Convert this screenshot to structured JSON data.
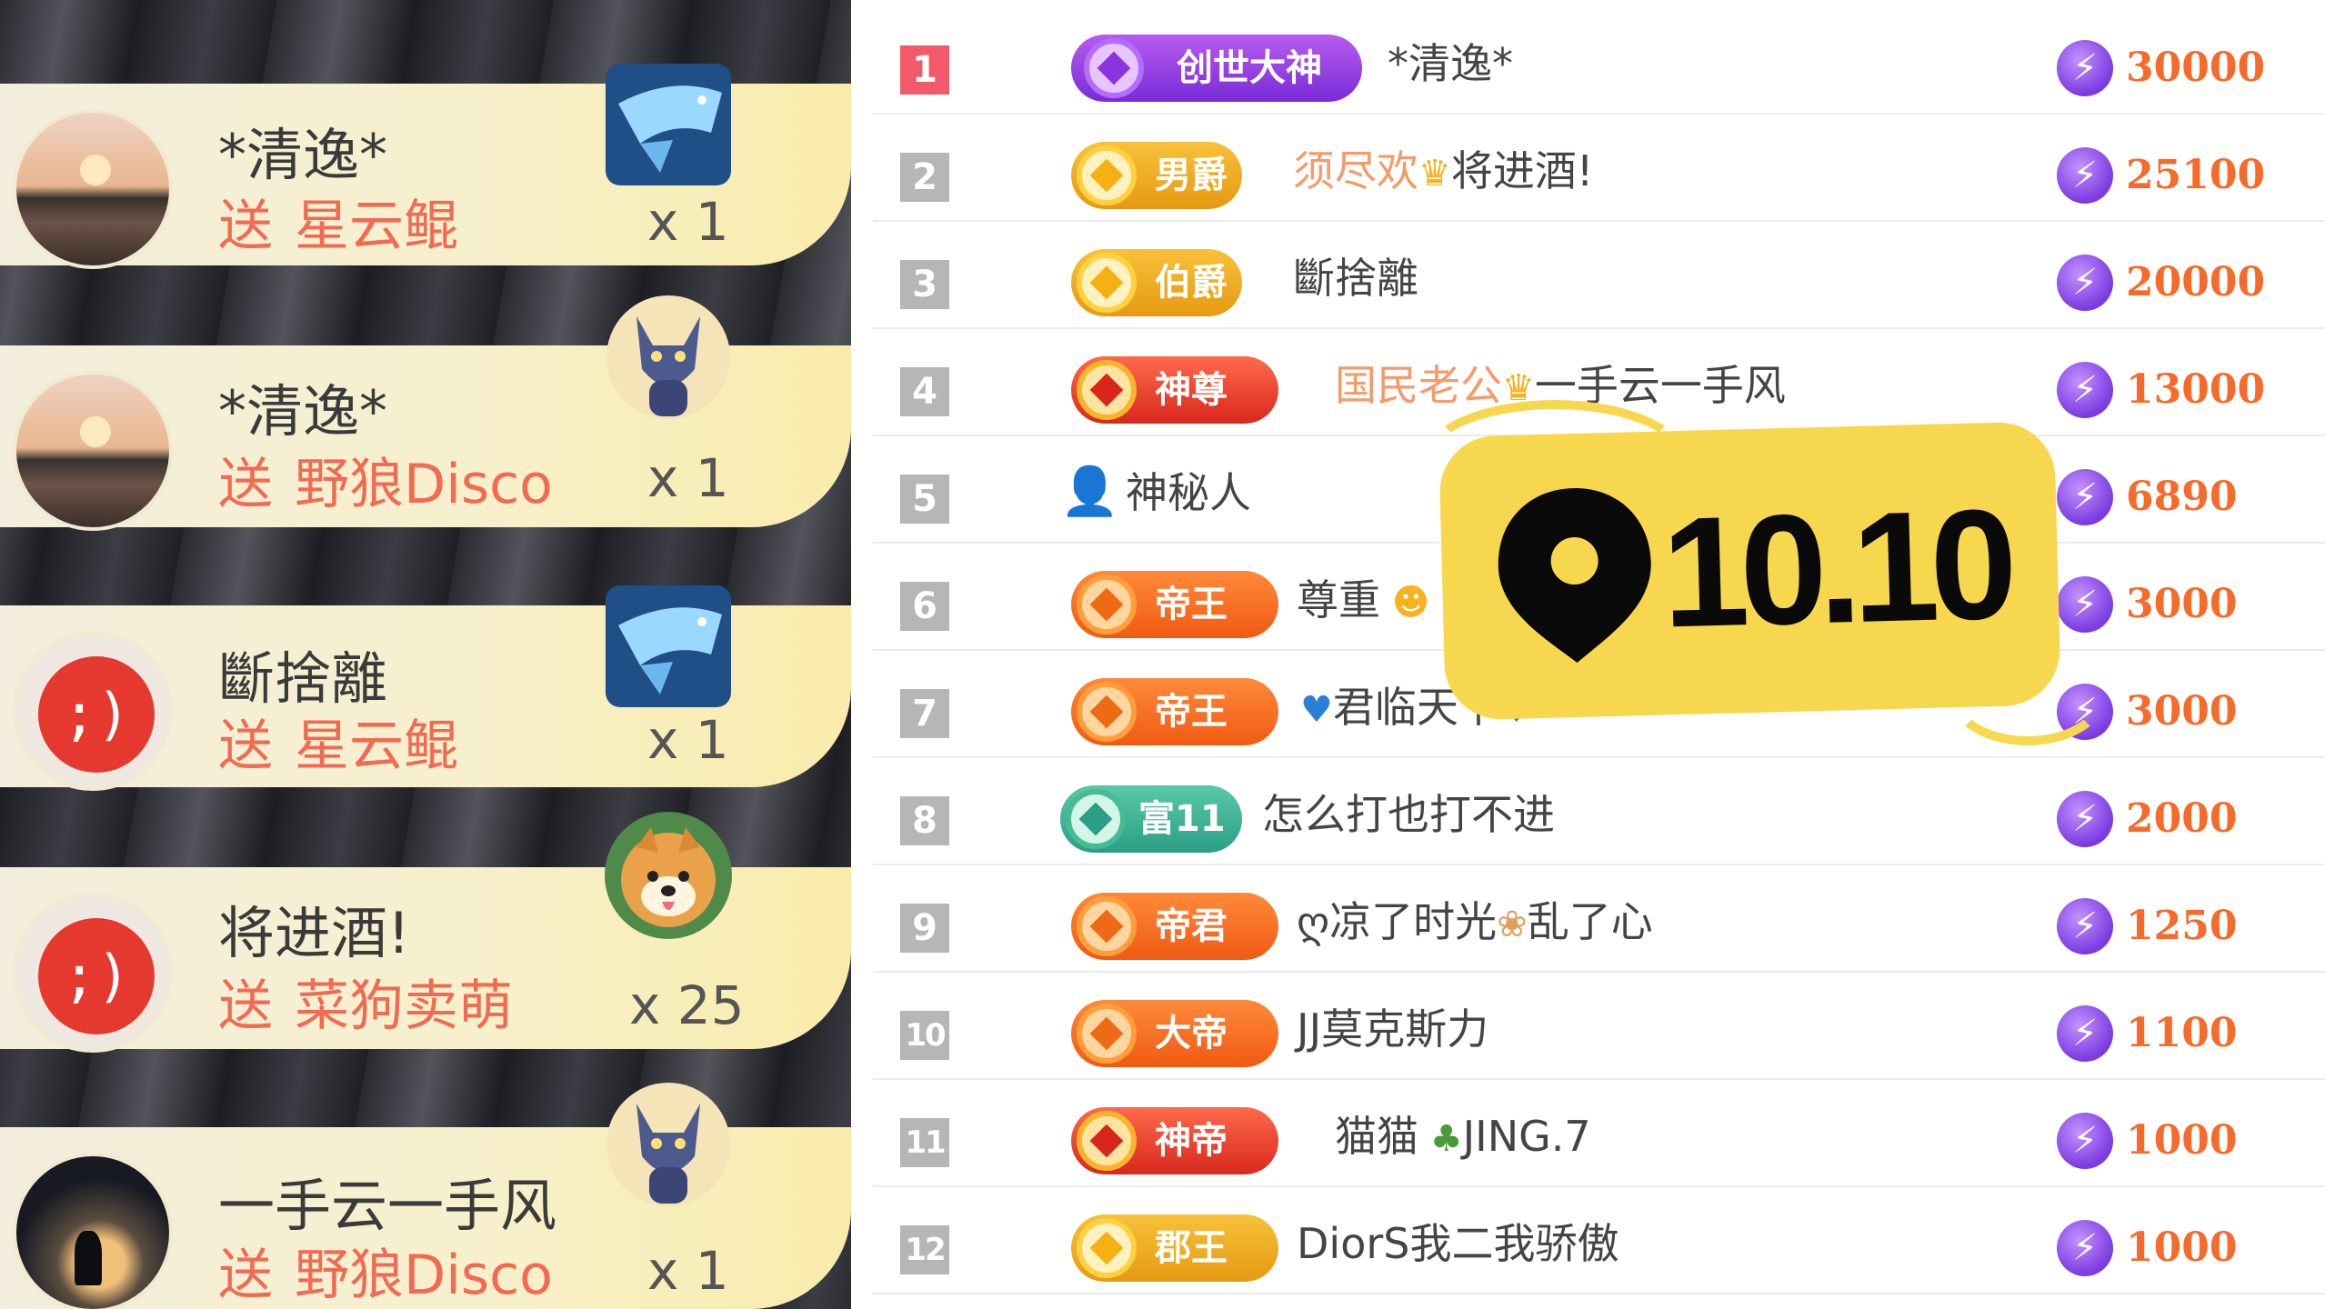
{
  "gift_feed": [
    {
      "user": "*清逸*",
      "verb": "送",
      "gift": "星云鲲",
      "count": "x 1",
      "avatar": "sunset-avatar",
      "gift_icon": "whale-gift-icon"
    },
    {
      "user": "*清逸*",
      "verb": "送",
      "gift": "野狼Disco",
      "count": "x 1",
      "avatar": "sunset-avatar",
      "gift_icon": "wolf-gift-icon"
    },
    {
      "user": "斷捨離",
      "verb": "送",
      "gift": "星云鲲",
      "count": "x 1",
      "avatar": "default-avatar",
      "gift_icon": "whale-gift-icon"
    },
    {
      "user": "将进酒!",
      "verb": "送",
      "gift": "菜狗卖萌",
      "count": "x 25",
      "avatar": "default-avatar",
      "gift_icon": "shiba-gift-icon"
    },
    {
      "user": "一手云一手风",
      "verb": "送",
      "gift": "野狼Disco",
      "count": "x 1",
      "avatar": "wolf-avatar",
      "gift_icon": "wolf-gift-icon"
    }
  ],
  "ranking": [
    {
      "rank": "1",
      "badge": "创世大神",
      "name": "*清逸*",
      "score": "30000"
    },
    {
      "rank": "2",
      "badge": "男爵",
      "name_highlight": "须尽欢",
      "name": "将进酒!",
      "score": "25100"
    },
    {
      "rank": "3",
      "badge": "伯爵",
      "name": "斷捨離",
      "score": "20000"
    },
    {
      "rank": "4",
      "badge": "神尊",
      "name_highlight": "国民老公",
      "name": "一手云一手风",
      "score": "13000"
    },
    {
      "rank": "5",
      "badge": "",
      "name": "神秘人",
      "score": "6890"
    },
    {
      "rank": "6",
      "badge": "帝王",
      "name": "尊重",
      "score": "3000"
    },
    {
      "rank": "7",
      "badge": "帝王",
      "name": "君临天下",
      "score": "3000"
    },
    {
      "rank": "8",
      "badge": "富11",
      "name": "怎么打也打不进",
      "score": "2000"
    },
    {
      "rank": "9",
      "badge": "帝君",
      "name_prefix": "ღ",
      "name": "凉了时光",
      "name_suffix": "乱了心",
      "score": "1250"
    },
    {
      "rank": "10",
      "badge": "大帝",
      "name": "JJ莫克斯力",
      "score": "1100"
    },
    {
      "rank": "11",
      "badge": "神帝",
      "name": "猫猫",
      "name_suffix": "JING.7",
      "score": "1000"
    },
    {
      "rank": "12",
      "badge": "郡王",
      "name": "DiorS我二我骄傲",
      "score": "1000"
    }
  ],
  "sticker": {
    "text": "10.10",
    "icon": "location-pin-icon"
  },
  "colors": {
    "score": "#f66a2a",
    "gift_action": "#f16a52",
    "sticker": "#f7d74e",
    "rank_top": "#f25a6a"
  }
}
